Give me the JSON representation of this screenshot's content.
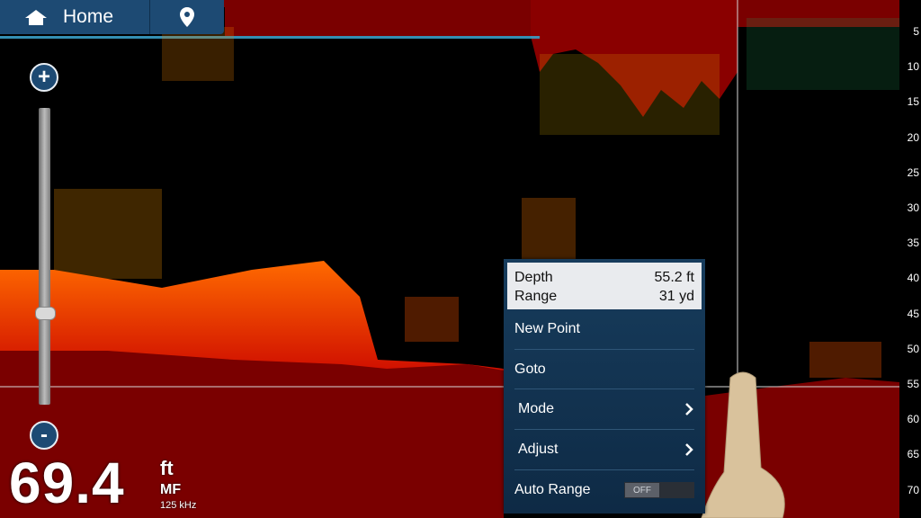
{
  "topbar": {
    "home_label": "Home"
  },
  "cursor_info": {
    "depth_label": "Depth",
    "depth_value": "55.2 ft",
    "range_label": "Range",
    "range_value": "31 yd"
  },
  "context_menu": {
    "items": [
      {
        "label": "New Point"
      },
      {
        "label": "Goto"
      },
      {
        "label": "Mode"
      },
      {
        "label": "Adjust"
      },
      {
        "label": "Auto Range"
      }
    ],
    "auto_range_toggle": "OFF"
  },
  "zoom": {
    "plus": "+",
    "minus": "-",
    "level": 0.16
  },
  "readout": {
    "depth": "69.4",
    "unit": "ft",
    "frequency_mode": "MF",
    "frequency": "125 kHz"
  },
  "depth_scale": [
    "5",
    "10",
    "15",
    "20",
    "25",
    "30",
    "35",
    "40",
    "45",
    "50",
    "55",
    "60",
    "65",
    "70"
  ],
  "colors": {
    "bottom": "#7a0000",
    "panel": "#1d4a73",
    "menu": "#173c5c"
  },
  "icons": [
    "home-icon",
    "waypoint-pin-icon",
    "chevron-right-icon",
    "finger-pointer"
  ]
}
